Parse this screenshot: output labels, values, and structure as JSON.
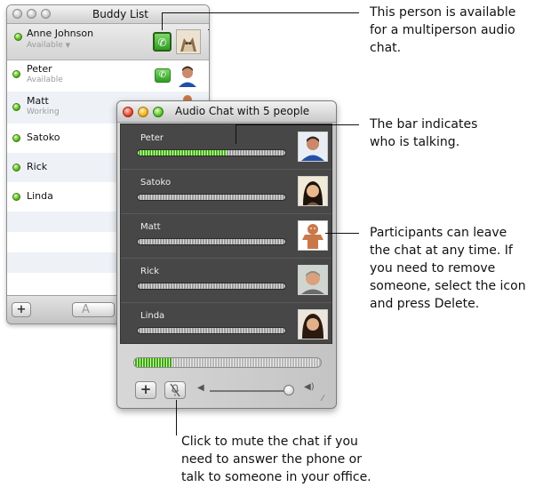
{
  "buddy_list": {
    "title": "Buddy List",
    "me": {
      "name": "Anne Johnson",
      "status": "Available",
      "status_dropdown_icon": "chevron-down-icon"
    },
    "buddies": [
      {
        "name": "Peter",
        "status": "Available"
      },
      {
        "name": "Matt",
        "status": "Working"
      },
      {
        "name": "Satoko",
        "status": ""
      },
      {
        "name": "Rick",
        "status": ""
      },
      {
        "name": "Linda",
        "status": ""
      }
    ],
    "bottom": {
      "add_label": "+",
      "text_chat_label": "A"
    }
  },
  "audio_chat": {
    "title": "Audio Chat with 5 people",
    "participants": [
      {
        "name": "Peter",
        "level": 0.6
      },
      {
        "name": "Satoko",
        "level": 0
      },
      {
        "name": "Matt",
        "level": 0
      },
      {
        "name": "Rick",
        "level": 0
      },
      {
        "name": "Linda",
        "level": 0
      }
    ],
    "mic_level": 0.2,
    "add_label": "+",
    "volume": 0.85
  },
  "callouts": {
    "available": "This person is available\nfor a multiperson audio\nchat.",
    "talking": "The bar indicates\nwho is talking.",
    "leave": "Participants can leave\nthe chat at any time. If\nyou need to remove\nsomeone, select the icon\nand press Delete.",
    "mute": "Click to mute the chat if you\nneed to answer the phone or\ntalk to someone in your office."
  },
  "colors": {
    "status_green": "#4fb81b",
    "talk_green": "#3ea815",
    "panel_dark": "#474747"
  }
}
